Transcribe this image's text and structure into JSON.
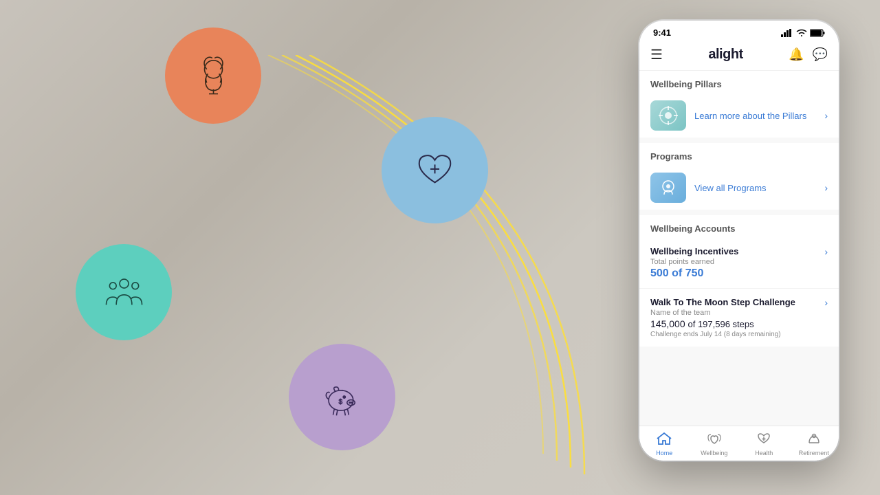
{
  "background": {
    "color": "#c8c3bb"
  },
  "circles": {
    "orange": {
      "icon": "brain-icon",
      "color": "#E8845A"
    },
    "blue": {
      "icon": "heart-medical-icon",
      "color": "#8BBFDF"
    },
    "teal": {
      "icon": "people-icon",
      "color": "#5DCFBE"
    },
    "purple": {
      "icon": "piggy-bank-icon",
      "color": "#B89FCE"
    }
  },
  "phone": {
    "status_bar": {
      "time": "9:41",
      "signal_icon": "signal-icon",
      "wifi_icon": "wifi-icon",
      "battery_icon": "battery-icon"
    },
    "header": {
      "menu_icon": "menu-icon",
      "logo": "alight",
      "bell_icon": "bell-icon",
      "message_icon": "message-icon"
    },
    "wellbeing_pillars": {
      "section_title": "Wellbeing Pillars",
      "link_text": "Learn more about the Pillars",
      "chevron": "›"
    },
    "programs": {
      "section_title": "Programs",
      "link_text": "View all Programs",
      "chevron": "›"
    },
    "wellbeing_accounts": {
      "section_title": "Wellbeing Accounts",
      "items": [
        {
          "name": "Wellbeing Incentives",
          "sublabel": "Total points earned",
          "value": "500 of 750",
          "chevron": "›"
        },
        {
          "name": "Walk To The Moon Step Challenge",
          "team_label": "Name of the team",
          "steps_value": "145,000",
          "steps_total": "of 197,596 steps",
          "ends_text": "Challenge ends July 14 (8 days remaining)",
          "chevron": "›"
        }
      ]
    },
    "bottom_nav": {
      "items": [
        {
          "label": "Home",
          "icon": "home-icon",
          "active": true
        },
        {
          "label": "Wellbeing",
          "icon": "wellbeing-icon",
          "active": false
        },
        {
          "label": "Health",
          "icon": "health-icon",
          "active": false
        },
        {
          "label": "Retirement",
          "icon": "retirement-icon",
          "active": false
        }
      ]
    }
  }
}
